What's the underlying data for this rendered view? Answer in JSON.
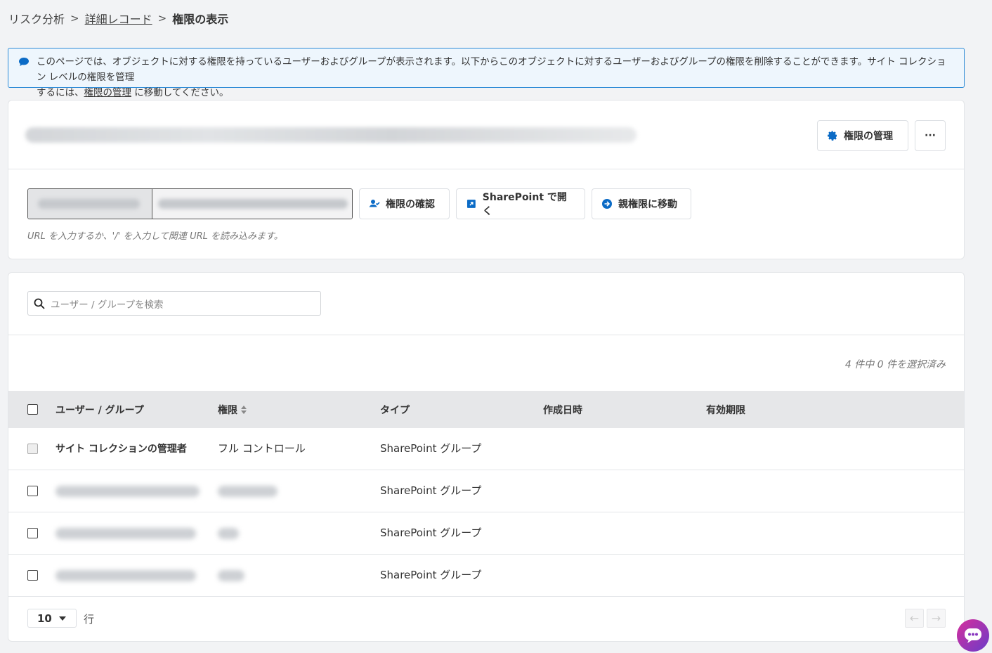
{
  "breadcrumb": {
    "item1": "リスク分析",
    "item2": "詳細レコード",
    "current": "権限の表示",
    "separator": ">"
  },
  "banner": {
    "text_line1": "このページでは、オブジェクトに対する権限を持っているユーザーおよびグループが表示されます。以下からこのオブジェクトに対するユーザーおよびグループの権限を削除することができます。サイト コレクション レベルの権限を管理",
    "text_line2_pre": "するには、",
    "link": "権限の管理",
    "text_line2_post": " に移動してください。"
  },
  "header_card": {
    "manage_button": "権限の管理",
    "more_button": "···"
  },
  "url_section": {
    "check_button": "権限の確認",
    "open_button": "SharePoint で開く",
    "parent_button": "親権限に移動",
    "hint": "URL を入力するか、'/' を入力して関連 URL を読み込みます。"
  },
  "table_section": {
    "search_placeholder": "ユーザー / グループを検索",
    "selection_count": "4 件中 0 件を選択済み",
    "columns": [
      "ユーザー / グループ",
      "権限",
      "タイプ",
      "作成日時",
      "有効期限"
    ],
    "rows": [
      {
        "name": "サイト コレクションの管理者",
        "permission": "フル コントロール",
        "type": "SharePoint グループ"
      },
      {
        "name": "",
        "permission": "",
        "type": "SharePoint グループ"
      },
      {
        "name": "",
        "permission": "",
        "type": "SharePoint グループ"
      },
      {
        "name": "",
        "permission": "",
        "type": "SharePoint グループ"
      }
    ],
    "page_size": "10",
    "rows_label": "行"
  },
  "colors": {
    "accent": "#0b6bc6",
    "banner_border": "#2e8bd6",
    "chat_gradient_start": "#d72e9c",
    "chat_gradient_end": "#6a3cc9"
  }
}
